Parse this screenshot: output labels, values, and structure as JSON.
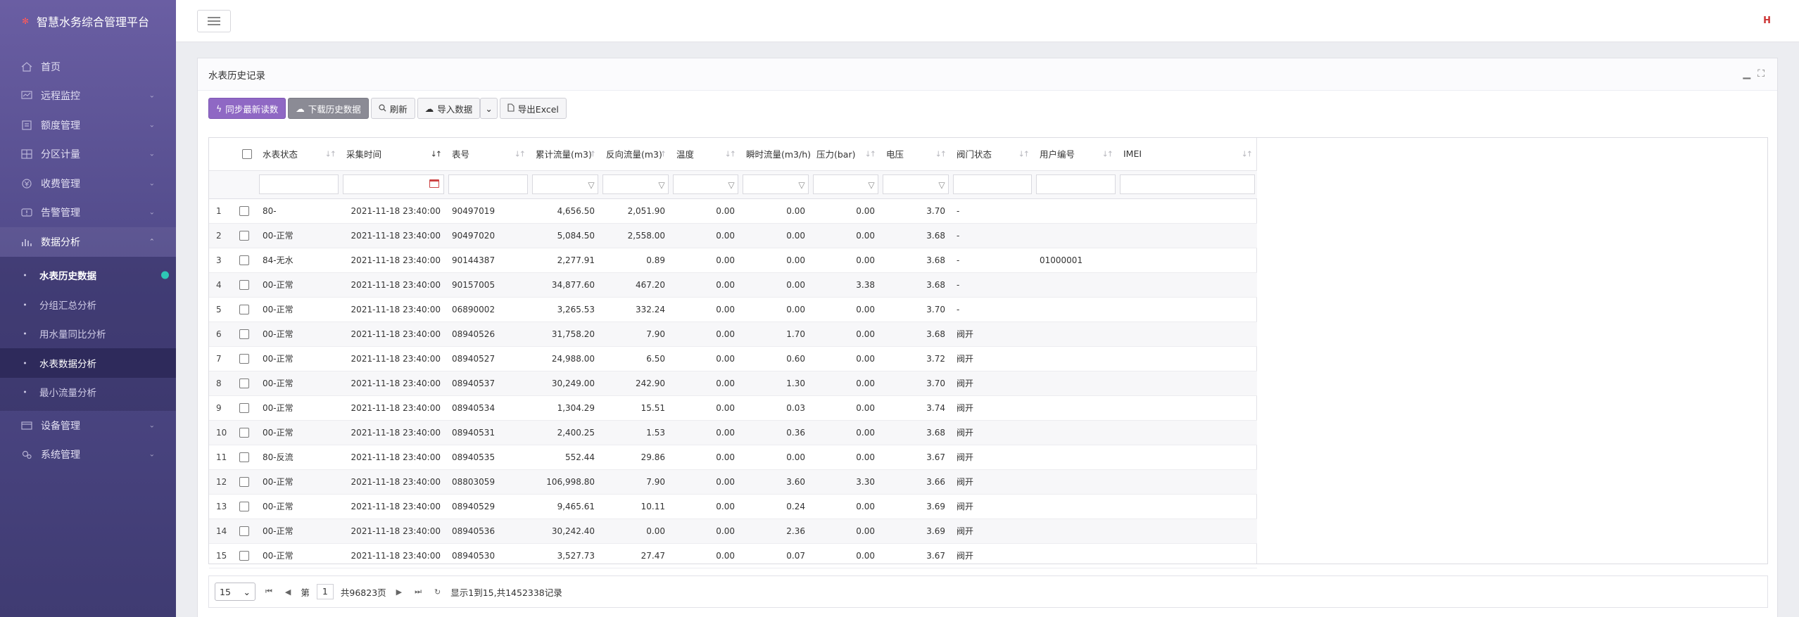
{
  "app": {
    "title": "智慧水务综合管理平台",
    "lang_flag": "H"
  },
  "sidebar": {
    "items": [
      {
        "label": "首页",
        "icon": "home-icon",
        "has_children": false
      },
      {
        "label": "远程监控",
        "icon": "monitor-icon",
        "has_children": true
      },
      {
        "label": "额度管理",
        "icon": "quota-icon",
        "has_children": true
      },
      {
        "label": "分区计量",
        "icon": "zone-icon",
        "has_children": true
      },
      {
        "label": "收费管理",
        "icon": "fee-icon",
        "has_children": true
      },
      {
        "label": "告警管理",
        "icon": "alarm-icon",
        "has_children": true
      },
      {
        "label": "数据分析",
        "icon": "chart-icon",
        "has_children": true,
        "expanded": true
      }
    ],
    "sub_items": [
      {
        "label": "水表历史数据",
        "state": "current",
        "badge": true
      },
      {
        "label": "分组汇总分析",
        "state": ""
      },
      {
        "label": "用水量同比分析",
        "state": ""
      },
      {
        "label": "水表数据分析",
        "state": "selected"
      },
      {
        "label": "最小流量分析",
        "state": ""
      }
    ],
    "items_after": [
      {
        "label": "设备管理",
        "icon": "device-icon",
        "has_children": true
      },
      {
        "label": "系统管理",
        "icon": "settings-icon",
        "has_children": true
      }
    ]
  },
  "panel": {
    "title": "水表历史记录"
  },
  "toolbar": {
    "sync_label": "同步最新读数",
    "download_label": "下载历史数据",
    "refresh_label": "刷新",
    "import_label": "导入数据",
    "export_label": "导出Excel"
  },
  "table": {
    "columns": [
      "水表状态",
      "采集时间",
      "表号",
      "累计流量(m3)",
      "反向流量(m3)",
      "温度",
      "瞬时流量(m3/h)",
      "压力(bar)",
      "电压",
      "阀门状态",
      "用户编号",
      "IMEI"
    ],
    "sorted_column": "采集时间",
    "rows": [
      [
        "1",
        "80-",
        "2021-11-18 23:40:00",
        "90497019",
        "4,656.50",
        "2,051.90",
        "0.00",
        "0.00",
        "0.00",
        "3.70",
        "-",
        "",
        ""
      ],
      [
        "2",
        "00-正常",
        "2021-11-18 23:40:00",
        "90497020",
        "5,084.50",
        "2,558.00",
        "0.00",
        "0.00",
        "0.00",
        "3.68",
        "-",
        "",
        ""
      ],
      [
        "3",
        "84-无水",
        "2021-11-18 23:40:00",
        "90144387",
        "2,277.91",
        "0.89",
        "0.00",
        "0.00",
        "0.00",
        "3.68",
        "-",
        "01000001",
        ""
      ],
      [
        "4",
        "00-正常",
        "2021-11-18 23:40:00",
        "90157005",
        "34,877.60",
        "467.20",
        "0.00",
        "0.00",
        "3.38",
        "3.68",
        "-",
        "",
        ""
      ],
      [
        "5",
        "00-正常",
        "2021-11-18 23:40:00",
        "06890002",
        "3,265.53",
        "332.24",
        "0.00",
        "0.00",
        "0.00",
        "3.70",
        "-",
        "",
        ""
      ],
      [
        "6",
        "00-正常",
        "2021-11-18 23:40:00",
        "08940526",
        "31,758.20",
        "7.90",
        "0.00",
        "1.70",
        "0.00",
        "3.68",
        "阀开",
        "",
        ""
      ],
      [
        "7",
        "00-正常",
        "2021-11-18 23:40:00",
        "08940527",
        "24,988.00",
        "6.50",
        "0.00",
        "0.60",
        "0.00",
        "3.72",
        "阀开",
        "",
        ""
      ],
      [
        "8",
        "00-正常",
        "2021-11-18 23:40:00",
        "08940537",
        "30,249.00",
        "242.90",
        "0.00",
        "1.30",
        "0.00",
        "3.70",
        "阀开",
        "",
        ""
      ],
      [
        "9",
        "00-正常",
        "2021-11-18 23:40:00",
        "08940534",
        "1,304.29",
        "15.51",
        "0.00",
        "0.03",
        "0.00",
        "3.74",
        "阀开",
        "",
        ""
      ],
      [
        "10",
        "00-正常",
        "2021-11-18 23:40:00",
        "08940531",
        "2,400.25",
        "1.53",
        "0.00",
        "0.36",
        "0.00",
        "3.68",
        "阀开",
        "",
        ""
      ],
      [
        "11",
        "80-反流",
        "2021-11-18 23:40:00",
        "08940535",
        "552.44",
        "29.86",
        "0.00",
        "0.00",
        "0.00",
        "3.67",
        "阀开",
        "",
        ""
      ],
      [
        "12",
        "00-正常",
        "2021-11-18 23:40:00",
        "08803059",
        "106,998.80",
        "7.90",
        "0.00",
        "3.60",
        "3.30",
        "3.66",
        "阀开",
        "",
        ""
      ],
      [
        "13",
        "00-正常",
        "2021-11-18 23:40:00",
        "08940529",
        "9,465.61",
        "10.11",
        "0.00",
        "0.24",
        "0.00",
        "3.69",
        "阀开",
        "",
        ""
      ],
      [
        "14",
        "00-正常",
        "2021-11-18 23:40:00",
        "08940536",
        "30,242.40",
        "0.00",
        "0.00",
        "2.36",
        "0.00",
        "3.69",
        "阀开",
        "",
        ""
      ],
      [
        "15",
        "00-正常",
        "2021-11-18 23:40:00",
        "08940530",
        "3,527.73",
        "27.47",
        "0.00",
        "0.07",
        "0.00",
        "3.67",
        "阀开",
        "",
        ""
      ]
    ]
  },
  "pager": {
    "page_size": "15",
    "page_prefix": "第",
    "current_page": "1",
    "total_pages": "共96823页",
    "summary": "显示1到15,共1452338记录"
  },
  "colors": {
    "sidebar_top": "#6a5ea3",
    "sidebar_bottom": "#3f3b72",
    "primary_button": "#8f68c4",
    "gray_button": "#8b8b95",
    "badge": "#2ec6b5"
  }
}
